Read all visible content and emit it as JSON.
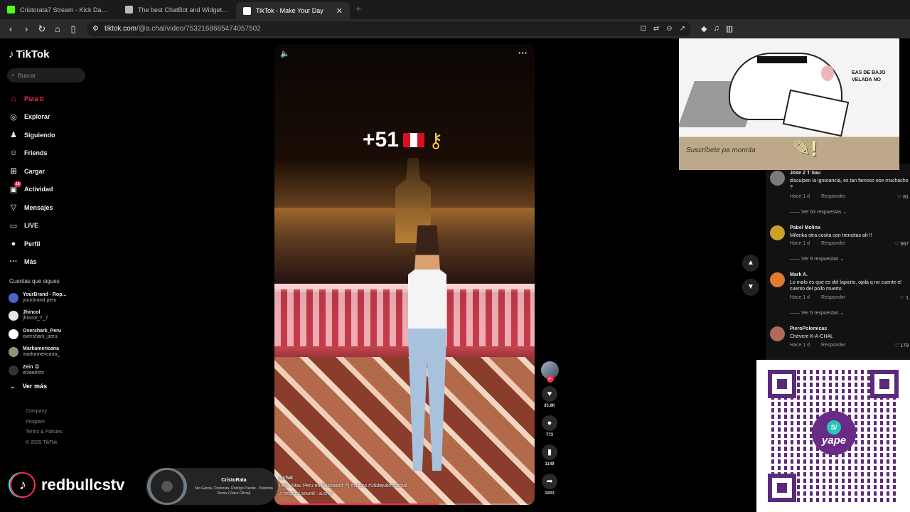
{
  "tabs": [
    {
      "title": "Cristorata7 Stream - Kick Dashboard",
      "color": "#53fc18"
    },
    {
      "title": "The best ChatBot and Widgets for Ki",
      "color": "#bbbbbb"
    },
    {
      "title": "TikTok - Make Your Day",
      "color": "#ffffff"
    }
  ],
  "url": {
    "host": "tiktok.com",
    "path": "/@a.chal/video/7532168685474057502"
  },
  "sidebar": {
    "logo": "TikTok",
    "search_placeholder": "Buscar",
    "menu": [
      {
        "label": "Para ti",
        "icon": "home-icon",
        "glyph": "⌂"
      },
      {
        "label": "Explorar",
        "icon": "compass-icon",
        "glyph": "◎"
      },
      {
        "label": "Siguiendo",
        "icon": "following-icon",
        "glyph": "♟"
      },
      {
        "label": "Friends",
        "icon": "friends-icon",
        "glyph": "☺"
      },
      {
        "label": "Cargar",
        "icon": "upload-icon",
        "glyph": "⊞"
      },
      {
        "label": "Actividad",
        "icon": "activity-icon",
        "glyph": "▣",
        "badge": "16"
      },
      {
        "label": "Mensajes",
        "icon": "messages-icon",
        "glyph": "▽"
      },
      {
        "label": "LIVE",
        "icon": "live-icon",
        "glyph": "▭"
      },
      {
        "label": "Perfil",
        "icon": "profile-icon",
        "glyph": "●"
      },
      {
        "label": "Más",
        "icon": "more-icon",
        "glyph": "···"
      }
    ],
    "following_title": "Cuentas que sigues",
    "following": [
      {
        "name": "YourBrand - Rop...",
        "handle": "yourbrand.peru",
        "color": "#4a66c9"
      },
      {
        "name": "Jhincol",
        "handle": "jhincol_7_7",
        "color": "#e6e6e6"
      },
      {
        "name": "Overshark_Peru",
        "handle": "overshark_peru",
        "color": "#ffffff"
      },
      {
        "name": "Markamericana",
        "handle": "markamericana_",
        "color": "#9a8f7a"
      },
      {
        "name": "Zein 😡",
        "handle": "elzeeinmr",
        "color": "#333333"
      }
    ],
    "ver_mas": "Ver más",
    "links": [
      "Company",
      "Program",
      "Terms & Policies",
      "© 2025 TikTok"
    ]
  },
  "video": {
    "overlay": "+51",
    "author": "a.chal",
    "caption": "Feliz 28av Peru es Password :*) #chuco #28dejulio #achal",
    "sound": "♫ original sound - a.chal",
    "progress": 0.63
  },
  "actions": {
    "likes": "35.9K",
    "comments": "773",
    "saves": "1149",
    "shares": "1203"
  },
  "comments": [
    {
      "name": "Jose Z T Sau",
      "text": "disculpen la ignorancia, es tan famoso ese muchacho ?",
      "time": "Hace 1 d",
      "reply": "Responder",
      "likes": "81",
      "replies": "Ver 63 respuestas",
      "color": "#7a7a7a"
    },
    {
      "name": "Pabel Molina",
      "text": "Milenka otra cosita con trencitas ah !!",
      "time": "Hace 1 d",
      "reply": "Responder",
      "likes": "567",
      "replies": "Ver 9 respuestas",
      "color": "#c9a227"
    },
    {
      "name": "Mark A.",
      "text": "Lo malo es que es del lapicito, ojalá q no cuente el cuento del pollo muerto",
      "time": "Hace 1 d",
      "reply": "Responder",
      "likes": "1",
      "replies": "Ver 5 respuestas",
      "color": "#e07a2e"
    },
    {
      "name": "PieroPolemicas",
      "text": "Chévere K-A-CHAL",
      "time": "Hace 1 d",
      "reply": "Responder",
      "likes": "179",
      "replies": "",
      "color": "#b06a5a"
    }
  ],
  "cat_overlay": {
    "text1": "EAS DE BAJO",
    "text2": "VELADA NO",
    "sub": "Suscríbete pa monrita"
  },
  "qr": {
    "label": "yape",
    "symbol": "S/"
  },
  "stream": {
    "channel": "redbullcstv",
    "music_title": "CristoRata",
    "music_artist": "Nio Garcia, Cristorata, Rodrigo Puente - Palomita Remix (Video Oficial)"
  }
}
